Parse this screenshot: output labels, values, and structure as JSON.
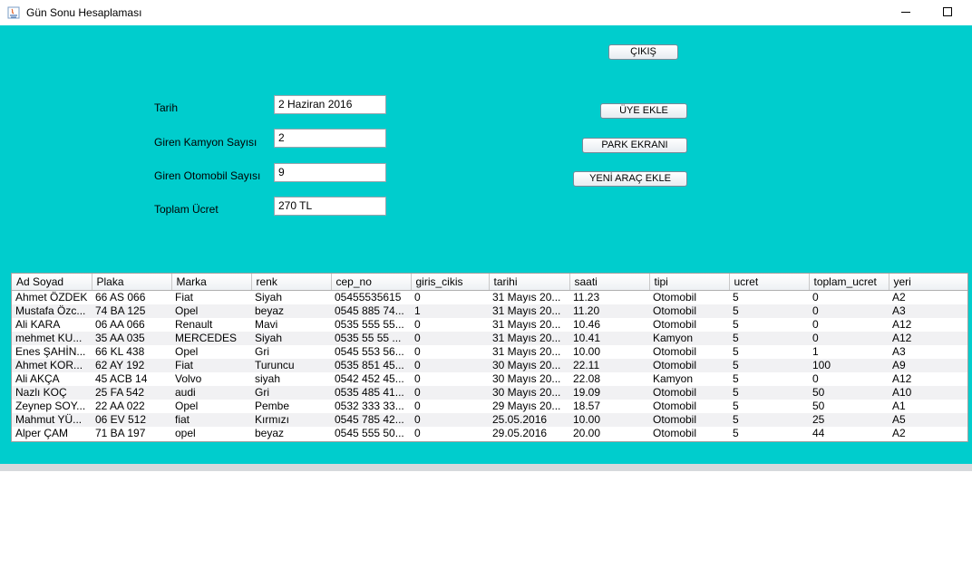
{
  "window": {
    "title": "Gün Sonu Hesaplaması"
  },
  "form": {
    "tarih_label": "Tarih",
    "tarih_value": "2 Haziran 2016",
    "kamyon_label": "Giren Kamyon Sayısı",
    "kamyon_value": "2",
    "otomobil_label": "Giren Otomobil Sayısı",
    "otomobil_value": "9",
    "ucret_label": "Toplam Ücret",
    "ucret_value": "270 TL"
  },
  "buttons": {
    "cikis": "ÇIKIŞ",
    "uye_ekle": "ÜYE EKLE",
    "park_ekrani": "PARK EKRANI",
    "yeni_arac": "YENİ ARAÇ EKLE"
  },
  "table": {
    "columns": [
      "Ad Soyad",
      "Plaka",
      "Marka",
      "renk",
      "cep_no",
      "giris_cikis",
      "tarihi",
      "saati",
      "tipi",
      "ucret",
      "toplam_ucret",
      "yeri"
    ],
    "rows": [
      [
        "Ahmet ÖZDEK",
        "66 AS 066",
        "Fiat",
        "Siyah",
        "05455535615",
        "0",
        "31 Mayıs 20...",
        "11.23",
        "Otomobil",
        "5",
        "0",
        "A2"
      ],
      [
        "Mustafa Özc...",
        "74 BA 125",
        "Opel",
        "beyaz",
        "0545 885 74...",
        "1",
        "31 Mayıs 20...",
        "11.20",
        "Otomobil",
        "5",
        "0",
        "A3"
      ],
      [
        "Ali KARA",
        "06 AA 066",
        "Renault",
        "Mavi",
        "0535 555 55...",
        "0",
        "31 Mayıs 20...",
        "10.46",
        "Otomobil",
        "5",
        "0",
        "A12"
      ],
      [
        "mehmet KU...",
        "35 AA 035",
        "MERCEDES",
        "Siyah",
        "0535 55 55 ...",
        "0",
        "31 Mayıs 20...",
        "10.41",
        "Kamyon",
        "5",
        "0",
        "A12"
      ],
      [
        "Enes ŞAHİN...",
        "66 KL 438",
        "Opel",
        "Gri",
        "0545 553 56...",
        "0",
        "31 Mayıs 20...",
        "10.00",
        "Otomobil",
        "5",
        "1",
        "A3"
      ],
      [
        "Ahmet KOR...",
        "62 AY 192",
        "Fiat",
        "Turuncu",
        "0535 851 45...",
        "0",
        "30 Mayıs 20...",
        "22.11",
        "Otomobil",
        "5",
        "100",
        "A9"
      ],
      [
        "Ali AKÇA",
        "45 ACB 14",
        "Volvo",
        "siyah",
        "0542 452 45...",
        "0",
        "30 Mayıs 20...",
        "22.08",
        "Kamyon",
        "5",
        "0",
        "A12"
      ],
      [
        "Nazlı KOÇ",
        "25 FA 542",
        "audi",
        "Gri",
        "0535 485 41...",
        "0",
        "30 Mayıs 20...",
        "19.09",
        "Otomobil",
        "5",
        "50",
        "A10"
      ],
      [
        "Zeynep SOY...",
        "22 AA 022",
        "Opel",
        "Pembe",
        "0532 333 33...",
        "0",
        "29 Mayıs 20...",
        "18.57",
        "Otomobil",
        "5",
        "50",
        "A1"
      ],
      [
        "Mahmut YÜ...",
        "06 EV 512",
        "fiat",
        "Kırmızı",
        "0545 785 42...",
        "0",
        "25.05.2016",
        "10.00",
        "Otomobil",
        "5",
        "25",
        "A5"
      ],
      [
        "Alper ÇAM",
        "71 BA 197",
        "opel",
        "beyaz",
        "0545 555 50...",
        "0",
        "29.05.2016",
        "20.00",
        "Otomobil",
        "5",
        "44",
        "A2"
      ]
    ]
  }
}
